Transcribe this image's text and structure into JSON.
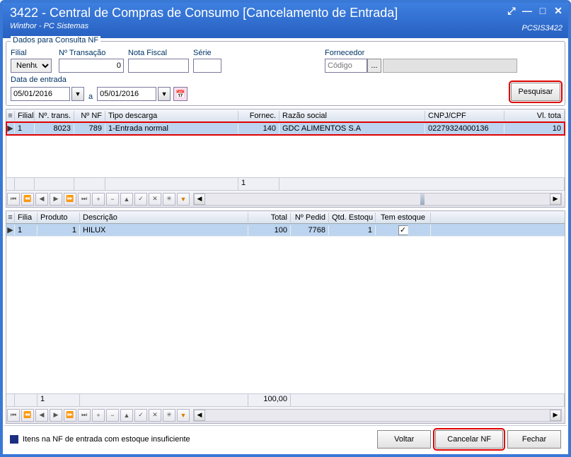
{
  "window": {
    "title": "3422 - Central de Compras de Consumo [Cancelamento de Entrada]",
    "subtitle": "Winthor - PC Sistemas",
    "code": "PCSIS3422"
  },
  "group_title": "Dados para Consulta NF",
  "labels": {
    "filial": "Filial",
    "ntrans": "Nº Transação",
    "nf": "Nota Fiscal",
    "serie": "Série",
    "fornecedor": "Fornecedor",
    "data_entrada": "Data de entrada",
    "a": "a"
  },
  "form": {
    "filial": "Nenhum",
    "ntrans": "0",
    "nf": "",
    "serie": "",
    "fornecedor_placeholder": "Código",
    "data1": "05/01/2016",
    "data2": "05/01/2016"
  },
  "buttons": {
    "pesquisar": "Pesquisar",
    "voltar": "Voltar",
    "cancelar": "Cancelar NF",
    "fechar": "Fechar",
    "lookup": "..."
  },
  "grid1": {
    "headers": [
      "Filial",
      "Nº. trans.",
      "Nº NF",
      "Tipo descarga",
      "Fornec.",
      "Razão social",
      "CNPJ/CPF",
      "Vl. tota"
    ],
    "row": [
      "1",
      "8023",
      "789",
      "1-Entrada normal",
      "140",
      "GDC ALIMENTOS S.A",
      "02279324000136",
      "10"
    ],
    "footer_val": "1"
  },
  "grid2": {
    "headers": [
      "Filia",
      "Produto",
      "Descrição",
      "Total",
      "Nº Pedid",
      "Qtd. Estoqu",
      "Tem estoque"
    ],
    "row": {
      "filial": "1",
      "produto": "1",
      "desc": "HILUX",
      "total": "100",
      "pedido": "7768",
      "qtd": "1",
      "tem": "✓"
    },
    "footer_col2": "1",
    "footer_col4": "100,00"
  },
  "legend": "Itens na NF de entrada com estoque insuficiente"
}
